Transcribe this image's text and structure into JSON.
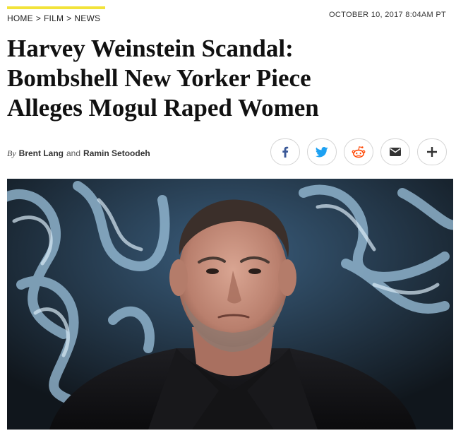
{
  "breadcrumb": {
    "items": [
      "HOME",
      "FILM",
      "NEWS"
    ],
    "separator": ">"
  },
  "dateline": "OCTOBER 10, 2017 8:04AM PT",
  "headline": {
    "line1": "Harvey Weinstein Scandal:",
    "line2": "Bombshell New Yorker Piece",
    "line3": "Alleges Mogul Raped Women"
  },
  "byline": {
    "by": "By",
    "author1": "Brent Lang",
    "conjunction": "and",
    "author2": "Ramin Setoodeh"
  },
  "share": {
    "buttons": [
      {
        "icon": "facebook-icon",
        "color": "#3b5998"
      },
      {
        "icon": "twitter-icon",
        "color": "#1da1f2"
      },
      {
        "icon": "reddit-icon",
        "color": "#ff4500"
      },
      {
        "icon": "email-icon",
        "color": "#333333"
      },
      {
        "icon": "plus-icon",
        "color": "#333333"
      }
    ]
  },
  "colors": {
    "accent_rule": "#f2e33a",
    "text": "#111111"
  }
}
